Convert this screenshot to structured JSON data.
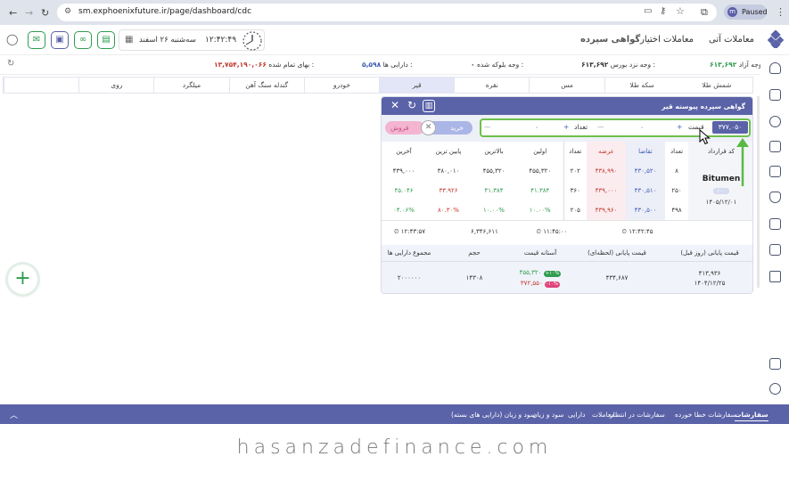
{
  "browser": {
    "url": "sm.exphoenixfuture.ir/page/dashboard/cdc",
    "profile_initial": "m",
    "profile_status": "Paused"
  },
  "header": {
    "tabs": [
      {
        "label": "معاملات آتی"
      },
      {
        "label": "معاملات اختیار"
      },
      {
        "label": "گواهی سپرده"
      }
    ],
    "time": "۱۲:۴۲:۴۹",
    "date": "سه‌شنبه ۲۶ اسفند"
  },
  "info_bar": {
    "free_cash_label": "وجه آزاد :",
    "free_cash_value": "۶۱۳,۶۹۲",
    "broker_cash_label": "وجه نزد بورس :",
    "broker_cash_value": "۶۱۳,۶۹۲",
    "blocked_label": "وجه بلوکه شده :",
    "blocked_value": "۰",
    "assets_label": "دارایی ها :",
    "assets_value": "۵,۵۹۸",
    "total_cost_label": "بهای تمام شده :",
    "total_cost_value": "۱۳,۷۵۴,۱۹۰,۰۶۶"
  },
  "commodity_tabs": [
    {
      "label": "شمش طلا"
    },
    {
      "label": "سکه طلا"
    },
    {
      "label": "مس"
    },
    {
      "label": "نقره"
    },
    {
      "label": "قیر"
    },
    {
      "label": "خودرو"
    },
    {
      "label": "گندله سنگ آهن"
    },
    {
      "label": "میلگرد"
    },
    {
      "label": "روی"
    },
    {
      "label": ""
    }
  ],
  "panel": {
    "title": "گواهی سپرده پیوسته قیر",
    "order": {
      "price_label": "قیمت",
      "price_value": "۳۷۷,۰۵۰",
      "qty_label": "تعداد",
      "qty_value": "۰",
      "value_field": "۰",
      "buy_label": "خرید",
      "sell_label": "فروش"
    },
    "book": {
      "headers": [
        "کد قرارداد",
        "تعداد",
        "تقاضا",
        "عرضه",
        "تعداد",
        "اولین",
        "بالاترین",
        "پایین ترین",
        "آخرین"
      ],
      "symbol": "Bitumen",
      "symbol_badge": "۱۰۰",
      "maturity": "۱۴۰۵/۱۲/۰۱",
      "rows": [
        {
          "bid_count": "۸",
          "bid": "۴۳۰,۵۲۰",
          "ask": "۴۳۸,۹۹۰",
          "ask_count": "۲۰۲",
          "first": "۴۵۵,۳۲۰",
          "high": "۴۵۵,۳۲۰",
          "low": "۳۸۰,۰۱۰",
          "last": "۴۳۹,۰۰۰"
        },
        {
          "bid_count": "۲۵۰",
          "bid": "۴۳۰,۵۱۰",
          "ask": "۴۳۹,۰۰۰",
          "ask_count": "۳۶۰",
          "first": "۴۱.۳۸۴",
          "high": "۴۱.۳۸۴",
          "low": "۳۳.۹۲۶",
          "last": "۴۵.۰۴۶"
        },
        {
          "bid_count": "۴۹۸",
          "bid": "۴۳۰,۵۰۰",
          "ask": "۴۳۹,۹۶۰",
          "ask_count": "۲۰۵",
          "first": "۱۰.۰۰%",
          "high": "۱۰.۰۰%",
          "low": "۸۰.۳۰%",
          "last": "۰۴.۰۶%"
        }
      ],
      "time_row": {
        "bid_time": "۱۲:۴۲:۴۵",
        "first_time": "۱۱:۴۵:۰۰",
        "volume": "۶,۳۴۶,۶۱۱",
        "last_time": "۱۲:۴۳:۵۷"
      }
    },
    "stats": {
      "headers": [
        "قیمت پایانی (روز قبل)",
        "قیمت پایانی (لحظه‌ای)",
        "آستانه قیمت",
        "حجم",
        "مجموع دارایی ها"
      ],
      "prev_close": "۴۱۳,۹۳۶",
      "prev_close_date": "۱۴۰۴/۱۲/۲۵",
      "close_now": "۴۳۴,۶۸۷",
      "upper_threshold": "۴۵۵,۳۲۰",
      "upper_pct": "+۱۰%",
      "lower_threshold": "۳۷۲,۵۵۰",
      "lower_pct": "-۱۰%",
      "volume": "۱۴۳۰۸",
      "total_assets": "۲۰۰۰۰۰۰"
    }
  },
  "bottom_bar": {
    "items": [
      {
        "label": "سفارشات"
      },
      {
        "label": "سفارشات خطا خورده"
      },
      {
        "label": "سفارشات در انتظار"
      },
      {
        "label": "معاملات"
      },
      {
        "label": "دارایی"
      },
      {
        "label": "سود و زیان"
      },
      {
        "label": "سود و زیان (دارایی های بسته)"
      }
    ]
  },
  "watermark": "hasanzadefinance.com",
  "colors": {
    "accent": "#5a62a8",
    "green": "#2e9c4f",
    "red": "#c0392b",
    "blue": "#3b5bb3"
  }
}
